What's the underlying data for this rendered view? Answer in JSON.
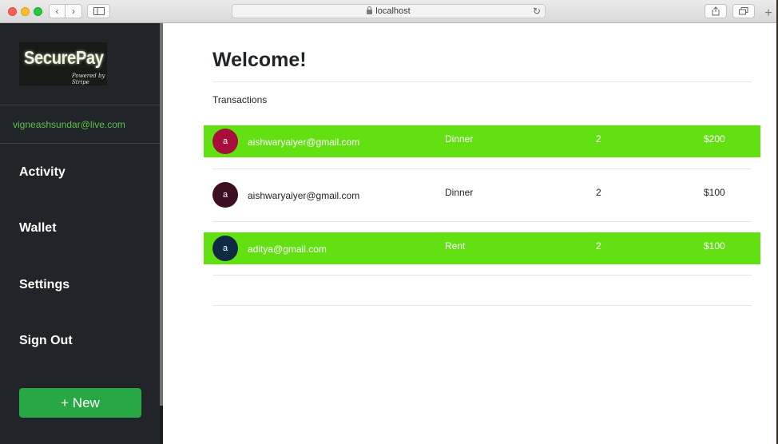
{
  "browser": {
    "url": "localhost",
    "back_glyph": "‹",
    "forward_glyph": "›",
    "new_tab_glyph": "+",
    "reload_glyph": "↻"
  },
  "sidebar": {
    "logo_text": "SecurePay",
    "logo_subtext": "Powered by Stripe",
    "user_email": "vigneashsundar@live.com",
    "nav": [
      {
        "label": "Activity"
      },
      {
        "label": "Wallet"
      },
      {
        "label": "Settings"
      },
      {
        "label": "Sign Out"
      }
    ],
    "new_button_label": "+ New"
  },
  "main": {
    "title": "Welcome!",
    "section_label": "Transactions",
    "transactions": [
      {
        "initial": "a",
        "email": "aishwaryaiyer@gmail.com",
        "description": "Dinner",
        "count": "2",
        "amount": "$200",
        "highlighted": true,
        "avatar_color": "#a50f3a"
      },
      {
        "initial": "a",
        "email": "aishwaryaiyer@gmail.com",
        "description": "Dinner",
        "count": "2",
        "amount": "$100",
        "highlighted": false,
        "avatar_color": "#3d0f22"
      },
      {
        "initial": "a",
        "email": "aditya@gmail.com",
        "description": "Rent",
        "count": "2",
        "amount": "$100",
        "highlighted": true,
        "avatar_color": "#0f2a44"
      }
    ]
  },
  "colors": {
    "sidebar_bg": "#212529",
    "highlight_row": "#62e012",
    "new_button": "#28a745",
    "email_green": "#5fbf4a"
  }
}
